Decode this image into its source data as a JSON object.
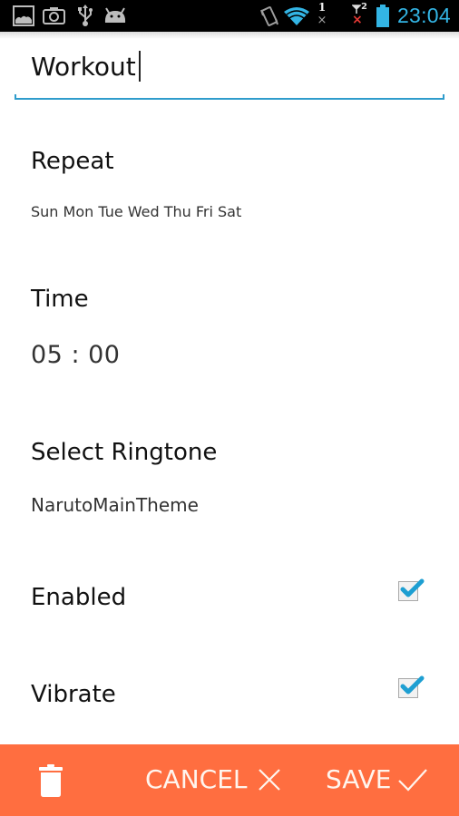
{
  "status_bar": {
    "left_icons": [
      "gallery-icon",
      "camera-icon",
      "usb-icon",
      "android-icon"
    ],
    "right_icons": [
      "vibrate-icon",
      "wifi-icon",
      "sim1-no-signal-icon",
      "sim2-no-signal-icon",
      "battery-icon"
    ],
    "sim1_label": "1",
    "sim2_label": "2",
    "time": "23:04",
    "accent_color": "#33b5e5"
  },
  "form": {
    "title_value": "Workout",
    "repeat": {
      "label": "Repeat",
      "value": "Sun Mon Tue Wed Thu Fri Sat"
    },
    "time": {
      "label": "Time",
      "value": "05 : 00"
    },
    "ringtone": {
      "label": "Select Ringtone",
      "value": "NarutoMainTheme"
    },
    "enabled": {
      "label": "Enabled",
      "checked": true
    },
    "vibrate": {
      "label": "Vibrate",
      "checked": true
    },
    "accent_color": "#2f9ccc"
  },
  "bottom_bar": {
    "background_color": "#ff6e40",
    "delete_icon": "trash-icon",
    "cancel_label": "CANCEL",
    "cancel_icon": "close-icon",
    "save_label": "SAVE",
    "save_icon": "check-icon"
  }
}
